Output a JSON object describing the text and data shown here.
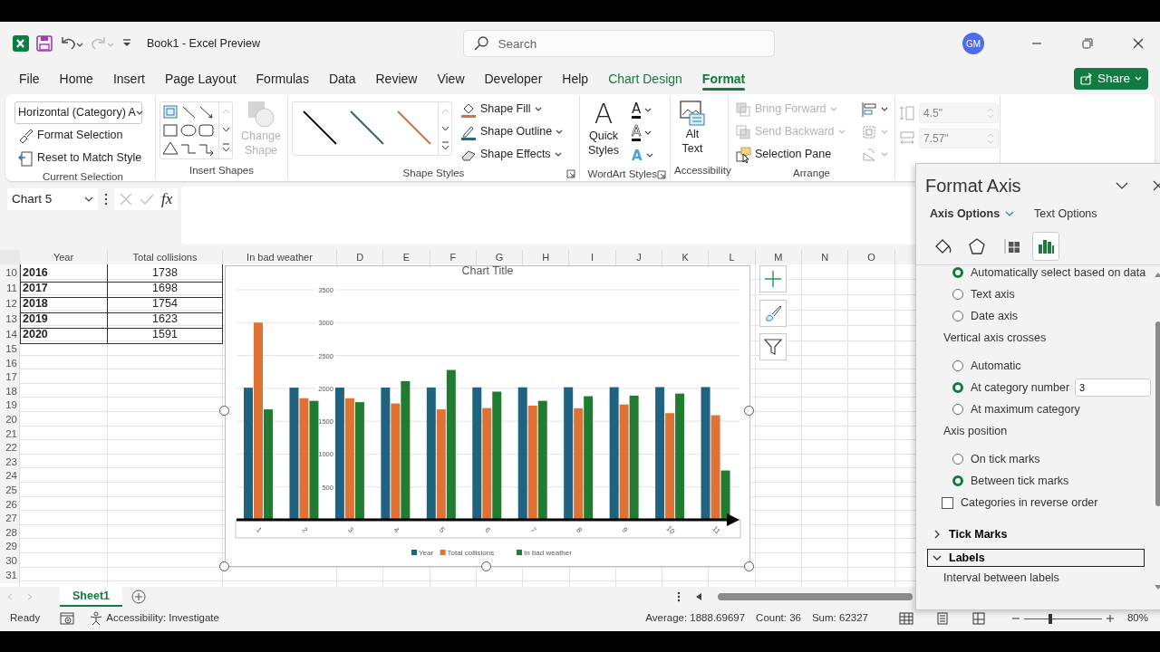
{
  "title_bar": {
    "title": "Book1  -  Excel Preview",
    "search": {
      "placeholder": "Search"
    },
    "avatar": "GM"
  },
  "menu_tabs": [
    {
      "label": "File",
      "selected": false,
      "kind": "plain"
    },
    {
      "label": "Home",
      "selected": false,
      "kind": "plain"
    },
    {
      "label": "Insert",
      "selected": false,
      "kind": "plain"
    },
    {
      "label": "Page Layout",
      "selected": false,
      "kind": "plain"
    },
    {
      "label": "Formulas",
      "selected": false,
      "kind": "plain"
    },
    {
      "label": "Data",
      "selected": false,
      "kind": "plain"
    },
    {
      "label": "Review",
      "selected": false,
      "kind": "plain"
    },
    {
      "label": "View",
      "selected": false,
      "kind": "plain"
    },
    {
      "label": "Developer",
      "selected": false,
      "kind": "plain"
    },
    {
      "label": "Help",
      "selected": false,
      "kind": "plain"
    },
    {
      "label": "Chart Design",
      "selected": false,
      "kind": "contextual"
    },
    {
      "label": "Format",
      "selected": true,
      "kind": "contextual"
    }
  ],
  "share_button": {
    "label": "Share"
  },
  "ribbon": {
    "groups": [
      {
        "kind": "current-selection",
        "label": "Current Selection",
        "dropdown": "Horizontal (Category) A",
        "buttons": [
          {
            "label": "Format Selection",
            "disabled": false
          },
          {
            "label": "Reset to Match Style",
            "disabled": false
          }
        ]
      },
      {
        "kind": "insert-shapes",
        "label": "Insert Shapes",
        "buttons": [
          {
            "label": "Change Shape",
            "disabled": true
          }
        ]
      },
      {
        "kind": "shape-styles",
        "label": "Shape Styles",
        "buttons": [
          {
            "label": "Shape Fill",
            "disabled": false
          },
          {
            "label": "Shape Outline",
            "disabled": false
          },
          {
            "label": "Shape Effects",
            "disabled": false
          }
        ]
      },
      {
        "kind": "wordart-styles",
        "label": "WordArt Styles",
        "letters": [
          "A",
          "A",
          "A",
          "A"
        ],
        "buttons": [
          {
            "label": "Quick Styles",
            "disabled": false
          }
        ]
      },
      {
        "kind": "accessibility",
        "label": "Accessibility",
        "buttons": [
          {
            "label": "Alt Text",
            "disabled": false
          }
        ]
      },
      {
        "kind": "arrange",
        "label": "Arrange",
        "buttons": [
          {
            "label": "Bring Forward",
            "disabled": true
          },
          {
            "label": "Send Backward",
            "disabled": true
          },
          {
            "label": "Selection Pane",
            "disabled": false
          }
        ]
      },
      {
        "kind": "size",
        "fields": [
          {
            "value": "4.5\"",
            "disabled": true
          },
          {
            "value": "7.57\"",
            "disabled": true
          }
        ]
      }
    ]
  },
  "formula_bar": {
    "name_box": "Chart 5",
    "function_label": "fx"
  },
  "sheet": {
    "columns": [
      "Year",
      "Total collisions",
      "In bad weather",
      "D",
      "E",
      "F",
      "G",
      "H",
      "I",
      "J",
      "K",
      "L",
      "M",
      "N",
      "O"
    ],
    "rows": [
      {
        "number": "10",
        "cells": [
          "2016",
          "1738"
        ]
      },
      {
        "number": "11",
        "cells": [
          "2017",
          "1698"
        ]
      },
      {
        "number": "12",
        "cells": [
          "2018",
          "1754"
        ]
      },
      {
        "number": "13",
        "cells": [
          "2019",
          "1623"
        ]
      },
      {
        "number": "14",
        "cells": [
          "2020",
          "1591"
        ]
      },
      {
        "number": "15"
      },
      {
        "number": "16"
      },
      {
        "number": "17"
      },
      {
        "number": "18"
      },
      {
        "number": "19"
      },
      {
        "number": "20"
      },
      {
        "number": "21"
      },
      {
        "number": "22"
      },
      {
        "number": "23"
      },
      {
        "number": "24"
      },
      {
        "number": "25"
      },
      {
        "number": "26"
      },
      {
        "number": "27"
      },
      {
        "number": "28"
      },
      {
        "number": "29"
      },
      {
        "number": "30"
      },
      {
        "number": "31"
      }
    ]
  },
  "chart": {
    "chart_data": {
      "type": "bar",
      "title": "Chart Title",
      "categories": [
        "1",
        "2",
        "3",
        "4",
        "5",
        "6",
        "7",
        "8",
        "9",
        "10",
        "11"
      ],
      "series": [
        {
          "name": "Year",
          "color": "#1f6380",
          "values": [
            2010,
            2011,
            2012,
            2013,
            2014,
            2015,
            2016,
            2017,
            2018,
            2019,
            2020
          ]
        },
        {
          "name": "Total collisions",
          "color": "#e07135",
          "values": [
            3000,
            1850,
            1850,
            1770,
            1680,
            1700,
            1738,
            1698,
            1754,
            1623,
            1591
          ]
        },
        {
          "name": "In bad weather",
          "color": "#217b31",
          "values": [
            1680,
            1810,
            1790,
            2110,
            2280,
            1950,
            1810,
            1880,
            1890,
            1920,
            750
          ]
        }
      ],
      "grid": true,
      "legend": true,
      "ylim": [
        0,
        3500
      ],
      "yticks": [
        500,
        1000,
        1500,
        2000,
        2500,
        3000,
        3500
      ]
    }
  },
  "format_pane": {
    "title": "Format Axis",
    "tabs": [
      {
        "label": "Axis Options",
        "selected": true
      },
      {
        "label": "Text Options",
        "selected": false
      }
    ],
    "icon_tabs": [
      {
        "selected": false
      },
      {
        "selected": false
      },
      {
        "selected": false
      },
      {
        "selected": true
      }
    ],
    "options": [
      {
        "kind": "radio",
        "label": "Automatically select based on data",
        "selected": true
      },
      {
        "kind": "radio",
        "label": "Text axis",
        "selected": false
      },
      {
        "kind": "radio",
        "label": "Date axis",
        "selected": false
      },
      {
        "kind": "heading",
        "label": "Vertical axis crosses"
      },
      {
        "kind": "radio",
        "label": "Automatic",
        "selected": false
      },
      {
        "kind": "radio",
        "label": "At category number",
        "selected": true,
        "value": "3"
      },
      {
        "kind": "radio",
        "label": "At maximum category",
        "selected": false
      },
      {
        "kind": "heading",
        "label": "Axis position"
      },
      {
        "kind": "radio",
        "label": "On tick marks",
        "selected": false
      },
      {
        "kind": "radio",
        "label": "Between tick marks",
        "selected": true
      },
      {
        "kind": "checkbox",
        "label": "Categories in reverse order",
        "checked": false
      },
      {
        "kind": "section",
        "label": "Tick Marks",
        "expanded": false
      },
      {
        "kind": "section",
        "label": "Labels",
        "expanded": true
      },
      {
        "kind": "heading",
        "label": "Interval between labels"
      }
    ]
  },
  "sheet_tabs": [
    {
      "label": "Sheet1",
      "selected": true
    }
  ],
  "status_bar": {
    "mode": "Ready",
    "accessibility": "Accessibility: Investigate",
    "average": "Average: 1888.69697",
    "count": "Count: 36",
    "sum": "Sum: 62327",
    "zoom": "80%",
    "zoom_slider": {
      "level": 0.34
    }
  }
}
